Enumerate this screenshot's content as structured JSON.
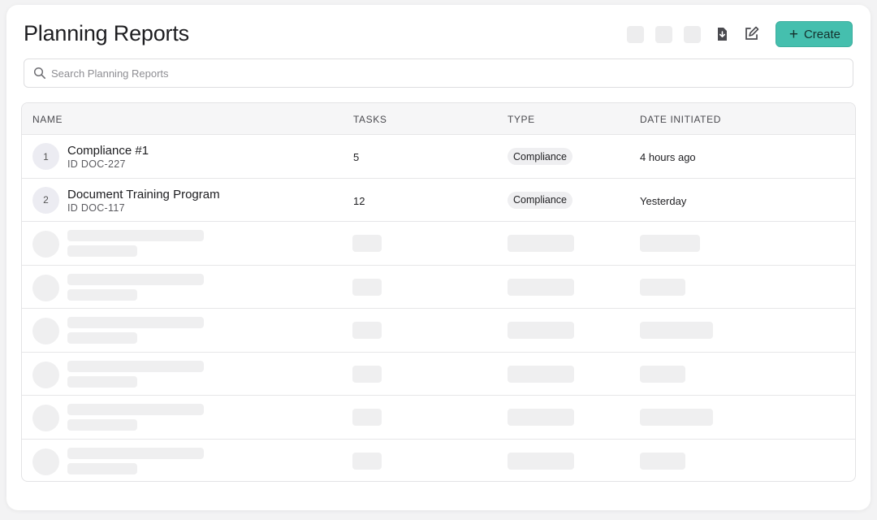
{
  "page": {
    "title": "Planning Reports",
    "search_placeholder": "Search Planning Reports"
  },
  "toolbar": {
    "create_label": "Create",
    "icons": [
      "download-icon",
      "edit-icon"
    ]
  },
  "table": {
    "columns": [
      "NAME",
      "TASKS",
      "TYPE",
      "DATE INITIATED"
    ],
    "rows": [
      {
        "index": "1",
        "name": "Compliance #1",
        "id": "ID DOC-227",
        "tasks": "5",
        "type": "Compliance",
        "date": "4 hours ago"
      },
      {
        "index": "2",
        "name": "Document Training Program",
        "id": "ID DOC-117",
        "tasks": "12",
        "type": "Compliance",
        "date": "Yesterday"
      }
    ]
  },
  "colors": {
    "accent": "#45bfae",
    "skeleton": "#efeff0"
  }
}
